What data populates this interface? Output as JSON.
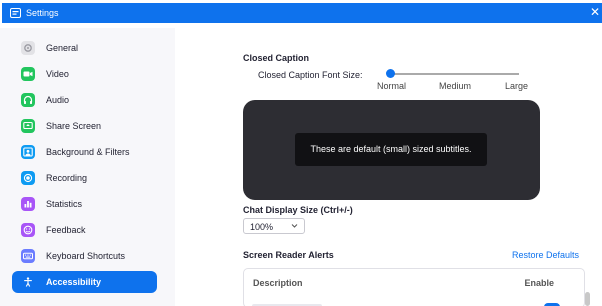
{
  "window": {
    "title": "Settings",
    "close_glyph": "✕"
  },
  "sidebar": {
    "items": [
      {
        "label": "General",
        "icon": "gear-icon",
        "color": "#d8d8dc",
        "active": false
      },
      {
        "label": "Video",
        "icon": "video-camera-icon",
        "color": "#22c55e",
        "active": false
      },
      {
        "label": "Audio",
        "icon": "headphones-icon",
        "color": "#22c55e",
        "active": false
      },
      {
        "label": "Share Screen",
        "icon": "share-screen-icon",
        "color": "#22c55e",
        "active": false
      },
      {
        "label": "Background & Filters",
        "icon": "person-background-icon",
        "color": "#0e9bf2",
        "active": false
      },
      {
        "label": "Recording",
        "icon": "record-icon",
        "color": "#0e9bf2",
        "active": false
      },
      {
        "label": "Statistics",
        "icon": "bar-chart-icon",
        "color": "#a855f7",
        "active": false
      },
      {
        "label": "Feedback",
        "icon": "smiley-icon",
        "color": "#a855f7",
        "active": false
      },
      {
        "label": "Keyboard Shortcuts",
        "icon": "keyboard-icon",
        "color": "#6b7cff",
        "active": false
      },
      {
        "label": "Accessibility",
        "icon": "accessibility-icon",
        "color": "#0e72ed",
        "active": true
      }
    ]
  },
  "closed_caption": {
    "title": "Closed Caption",
    "font_size_label": "Closed Caption Font Size:",
    "slider_ticks": [
      "Normal",
      "Medium",
      "Large"
    ],
    "slider_value": "Normal",
    "preview_text": "These are default (small) sized subtitles."
  },
  "chat": {
    "title": "Chat Display Size (Ctrl+/-)",
    "selected": "100%"
  },
  "screen_reader": {
    "title": "Screen Reader Alerts",
    "restore_label": "Restore Defaults",
    "columns": [
      "Description",
      "Enable"
    ]
  },
  "colors": {
    "accent": "#0e72ed",
    "sidebar_bg": "#f7f7fa",
    "preview_bg": "#2d2d33"
  }
}
